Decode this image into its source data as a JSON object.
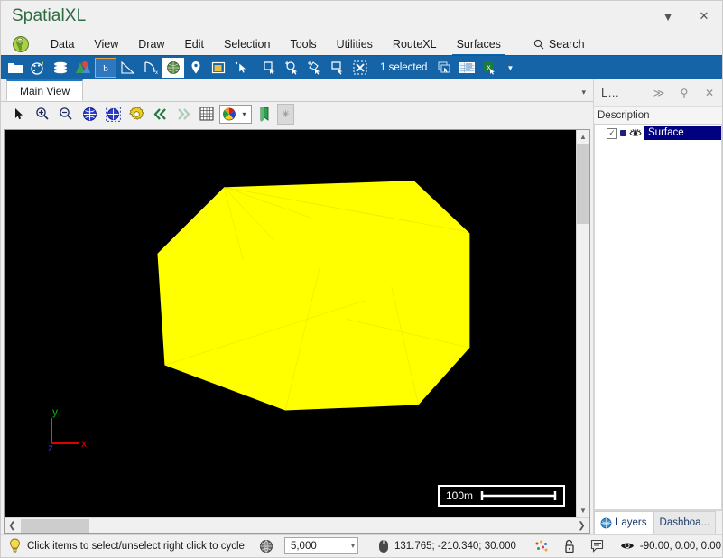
{
  "window": {
    "title": "SpatialXL",
    "title_color": "#2e6b41",
    "buttons": [
      {
        "name": "dropdown",
        "glyph": "▼"
      },
      {
        "name": "close",
        "glyph": "✕"
      }
    ]
  },
  "menubar": {
    "logo_icon": "globe-africa-icon",
    "items": [
      {
        "label": "Data",
        "active": false
      },
      {
        "label": "View",
        "active": false
      },
      {
        "label": "Draw",
        "active": false
      },
      {
        "label": "Edit",
        "active": false
      },
      {
        "label": "Selection",
        "active": false
      },
      {
        "label": "Tools",
        "active": false
      },
      {
        "label": "Utilities",
        "active": false
      },
      {
        "label": "RouteXL",
        "active": false
      },
      {
        "label": "Surfaces",
        "active": true
      }
    ],
    "search_label": "Search",
    "accent_color": "#1064a8"
  },
  "ribbon": {
    "background": "#1564a8",
    "status_label": "1 selected",
    "icons": [
      "open-folder-icon",
      "palette-pin-icon",
      "layers-stack-icon",
      "map-marker-icon",
      "boundary-icon",
      "measure-angle-icon",
      "coordinate-curve-icon",
      "globe-icon",
      "location-pin-icon",
      "page-layout-icon",
      "select-pointer-icon",
      "select-rect-icon",
      "select-polygon-icon",
      "select-circle-icon",
      "select-lasso-icon",
      "select-box-icon",
      "clear-selection-icon"
    ],
    "trailing_icons": [
      "duplicate-selection-icon",
      "attribute-table-icon",
      "export-excel-icon"
    ],
    "overflow_glyph": "▼"
  },
  "document": {
    "tab_label": "Main View",
    "tabstrip_caret": "▾"
  },
  "view_toolbar": {
    "icons": [
      "pointer-icon",
      "zoom-in-icon",
      "zoom-out-icon",
      "zoom-extents-icon",
      "zoom-selection-icon",
      "settings-gear-icon",
      "previous-view-icon",
      "next-view-icon",
      "grid-icon",
      "color-legend-icon",
      "bookmark-icon",
      "favorite-star-icon"
    ],
    "combo_caret": "▾",
    "star_glyph": "✳"
  },
  "canvas": {
    "background": "#000000",
    "surface_color": "#ffff00",
    "surface_name": "Surface",
    "scalebar_label": "100m",
    "axis": {
      "x_label": "x",
      "x_color": "#dd0000",
      "y_label": "y",
      "y_color": "#00aa00",
      "z_label": "z",
      "z_color": "#2222dd"
    },
    "scroll": {
      "up_glyph": "▲",
      "down_glyph": "▼",
      "left_glyph": "❮",
      "right_glyph": "❯"
    }
  },
  "right_panel": {
    "title": "L...",
    "header_buttons": [
      {
        "name": "forward",
        "glyph": "≫"
      },
      {
        "name": "pin",
        "glyph": "⚲"
      },
      {
        "name": "close",
        "glyph": "✕"
      }
    ],
    "column_header": "Description",
    "layers": [
      {
        "checked": true,
        "check_glyph": "✓",
        "visibility_icon": "eye-icon",
        "name": "Surface",
        "selected": true,
        "highlight_color": "#000080"
      }
    ],
    "tabs": [
      {
        "label": "Layers",
        "icon": "globe-icon",
        "active": true
      },
      {
        "label": "Dashboa...",
        "icon": "",
        "active": false
      }
    ]
  },
  "statusbar": {
    "hint_icon": "lightbulb-icon",
    "hint_text": "Click items to select/unselect right click to cycle",
    "projection_icon": "globe-wire-icon",
    "scale_value": "5,000",
    "scale_caret": "▾",
    "mouse_icon": "mouse-icon",
    "coordinates": "131.765; -210.340; 30.000",
    "snap_icon": "snap-dots-icon",
    "lock_icon": "unlocked-padlock-icon",
    "message_icon": "message-icon",
    "view_icon": "eye-icon",
    "view_angles": "-90.00, 0.00, 0.00"
  }
}
